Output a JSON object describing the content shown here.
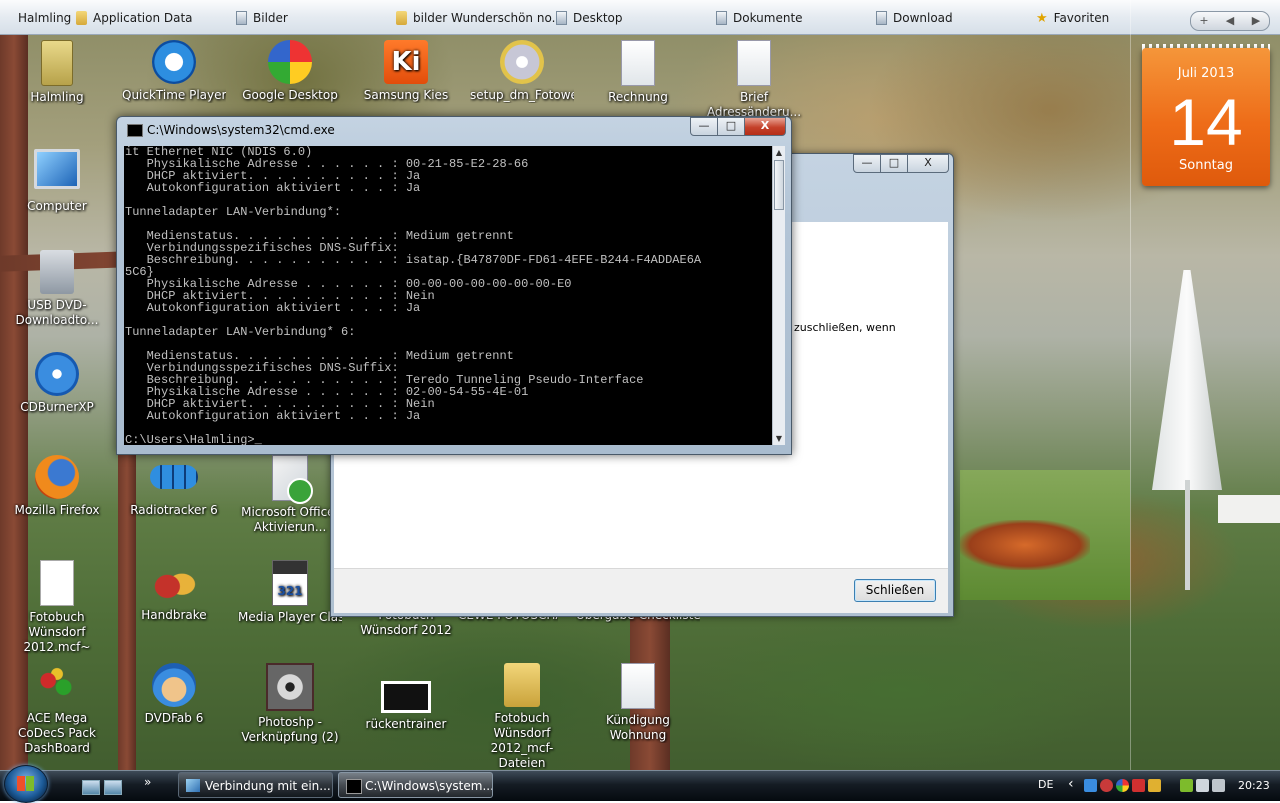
{
  "toolbar": {
    "items": [
      {
        "label": "Halmling",
        "icon": "none"
      },
      {
        "label": "Application Data",
        "icon": "folder-icon"
      },
      {
        "label": "Bilder",
        "icon": "document-icon"
      },
      {
        "label": "bilder Wunderschön no...",
        "icon": "folder-icon"
      },
      {
        "label": "Desktop",
        "icon": "document-icon"
      },
      {
        "label": "Dokumente",
        "icon": "document-icon"
      },
      {
        "label": "Download",
        "icon": "document-icon"
      },
      {
        "label": "Favoriten",
        "icon": "star-icon"
      }
    ],
    "add_label": "+",
    "prev_label": "◀",
    "next_label": "▶"
  },
  "calendar": {
    "month": "Juli 2013",
    "day": "14",
    "weekday": "Sonntag"
  },
  "desktop_icons": [
    {
      "label": "Halmling",
      "icon": "user-folder-icon"
    },
    {
      "label": "QuickTime Player",
      "icon": "quicktime-icon"
    },
    {
      "label": "Google Desktop",
      "icon": "google-desktop-icon"
    },
    {
      "label": "Samsung Kies",
      "icon": "samsung-kies-icon"
    },
    {
      "label": "setup_dm_Fotowelt",
      "icon": "setup-icon"
    },
    {
      "label": "Rechnung",
      "icon": "document-icon"
    },
    {
      "label": "Brief Adressänderu...",
      "icon": "document-icon"
    },
    {
      "label": "Computer",
      "icon": "computer-icon"
    },
    {
      "label": "USB DVD-Downloadto...",
      "icon": "usb-dvd-icon"
    },
    {
      "label": "CDBurnerXP",
      "icon": "cdburner-icon"
    },
    {
      "label": "Mozilla Firefox",
      "icon": "firefox-icon"
    },
    {
      "label": "Radiotracker 6",
      "icon": "radiotracker-icon"
    },
    {
      "label": "Microsoft Office-Aktivierun...",
      "icon": "office-activation-icon"
    },
    {
      "label": "Fotobuch Wünsdorf 2012.mcf~",
      "icon": "file-icon"
    },
    {
      "label": "Handbrake",
      "icon": "handbrake-icon"
    },
    {
      "label": "Media Player Classic",
      "icon": "media-player-icon"
    },
    {
      "label": "Fotobuch Wünsdorf 2012",
      "icon": "hidden-icon"
    },
    {
      "label": "CEWE FOTOSCHAU",
      "icon": "hidden-icon"
    },
    {
      "label": "Übergabe-Checkliste",
      "icon": "hidden-icon"
    },
    {
      "label": "ACE Mega CoDecS Pack DashBoard",
      "icon": "codec-icon"
    },
    {
      "label": "DVDFab 6",
      "icon": "dvdfab-icon"
    },
    {
      "label": "Photoshp - Verknüpfung (2)",
      "icon": "photoshop-icon"
    },
    {
      "label": "rückentrainer",
      "icon": "video-icon"
    },
    {
      "label": "Fotobuch Wünsdorf 2012_mcf-Dateien",
      "icon": "folder-icon"
    },
    {
      "label": "Kündigung Wohnung",
      "icon": "document-icon"
    }
  ],
  "cmd": {
    "title": "C:\\Windows\\system32\\cmd.exe",
    "lines": [
      "it Ethernet NIC (NDIS 6.0)",
      "   Physikalische Adresse . . . . . . : 00-21-85-E2-28-66",
      "   DHCP aktiviert. . . . . . . . . . : Ja",
      "   Autokonfiguration aktiviert . . . : Ja",
      "",
      "Tunneladapter LAN-Verbindung*:",
      "",
      "   Medienstatus. . . . . . . . . . . : Medium getrennt",
      "   Verbindungsspezifisches DNS-Suffix:",
      "   Beschreibung. . . . . . . . . . . : isatap.{B47870DF-FD61-4EFE-B244-F4ADDAE6A",
      "5C6}",
      "   Physikalische Adresse . . . . . . : 00-00-00-00-00-00-00-E0",
      "   DHCP aktiviert. . . . . . . . . . : Nein",
      "   Autokonfiguration aktiviert . . . : Ja",
      "",
      "Tunneladapter LAN-Verbindung* 6:",
      "",
      "   Medienstatus. . . . . . . . . . . : Medium getrennt",
      "   Verbindungsspezifisches DNS-Suffix:",
      "   Beschreibung. . . . . . . . . . . : Teredo Tunneling Pseudo-Interface",
      "   Physikalische Adresse . . . . . . : 02-00-54-55-4E-01",
      "   DHCP aktiviert. . . . . . . . . . : Nein",
      "   Autokonfiguration aktiviert . . . : Ja",
      "",
      "C:\\Users\\Halmling>_"
    ]
  },
  "dialog": {
    "text_fragment": "zuschließen, wenn",
    "close_label": "Schließen"
  },
  "window_buttons": {
    "minimize": "—",
    "maximize": "□",
    "close": "X"
  },
  "taskbar": {
    "overflow_label": "»",
    "tasks": [
      {
        "label": "Verbindung mit ein...",
        "active": false
      },
      {
        "label": "C:\\Windows\\system...",
        "active": true
      }
    ],
    "language": "DE",
    "tray_expand": "‹",
    "clock": "20:23"
  }
}
